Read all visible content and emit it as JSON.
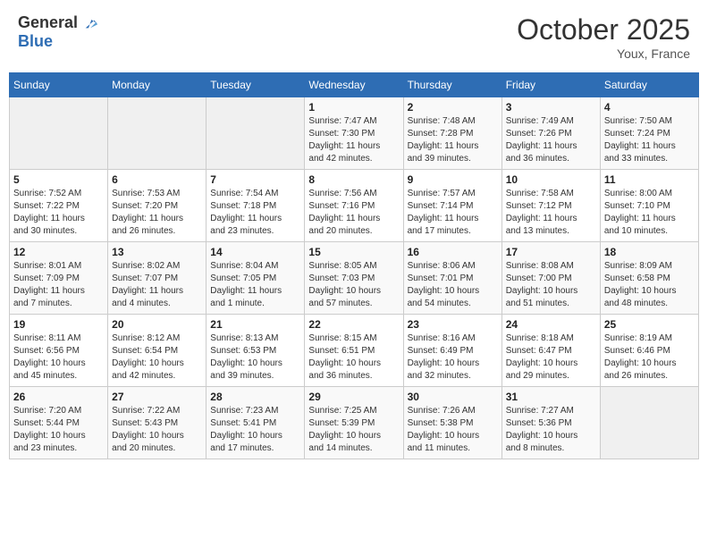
{
  "header": {
    "logo_general": "General",
    "logo_blue": "Blue",
    "month": "October 2025",
    "location": "Youx, France"
  },
  "weekdays": [
    "Sunday",
    "Monday",
    "Tuesday",
    "Wednesday",
    "Thursday",
    "Friday",
    "Saturday"
  ],
  "weeks": [
    [
      {
        "day": "",
        "info": ""
      },
      {
        "day": "",
        "info": ""
      },
      {
        "day": "",
        "info": ""
      },
      {
        "day": "1",
        "info": "Sunrise: 7:47 AM\nSunset: 7:30 PM\nDaylight: 11 hours\nand 42 minutes."
      },
      {
        "day": "2",
        "info": "Sunrise: 7:48 AM\nSunset: 7:28 PM\nDaylight: 11 hours\nand 39 minutes."
      },
      {
        "day": "3",
        "info": "Sunrise: 7:49 AM\nSunset: 7:26 PM\nDaylight: 11 hours\nand 36 minutes."
      },
      {
        "day": "4",
        "info": "Sunrise: 7:50 AM\nSunset: 7:24 PM\nDaylight: 11 hours\nand 33 minutes."
      }
    ],
    [
      {
        "day": "5",
        "info": "Sunrise: 7:52 AM\nSunset: 7:22 PM\nDaylight: 11 hours\nand 30 minutes."
      },
      {
        "day": "6",
        "info": "Sunrise: 7:53 AM\nSunset: 7:20 PM\nDaylight: 11 hours\nand 26 minutes."
      },
      {
        "day": "7",
        "info": "Sunrise: 7:54 AM\nSunset: 7:18 PM\nDaylight: 11 hours\nand 23 minutes."
      },
      {
        "day": "8",
        "info": "Sunrise: 7:56 AM\nSunset: 7:16 PM\nDaylight: 11 hours\nand 20 minutes."
      },
      {
        "day": "9",
        "info": "Sunrise: 7:57 AM\nSunset: 7:14 PM\nDaylight: 11 hours\nand 17 minutes."
      },
      {
        "day": "10",
        "info": "Sunrise: 7:58 AM\nSunset: 7:12 PM\nDaylight: 11 hours\nand 13 minutes."
      },
      {
        "day": "11",
        "info": "Sunrise: 8:00 AM\nSunset: 7:10 PM\nDaylight: 11 hours\nand 10 minutes."
      }
    ],
    [
      {
        "day": "12",
        "info": "Sunrise: 8:01 AM\nSunset: 7:09 PM\nDaylight: 11 hours\nand 7 minutes."
      },
      {
        "day": "13",
        "info": "Sunrise: 8:02 AM\nSunset: 7:07 PM\nDaylight: 11 hours\nand 4 minutes."
      },
      {
        "day": "14",
        "info": "Sunrise: 8:04 AM\nSunset: 7:05 PM\nDaylight: 11 hours\nand 1 minute."
      },
      {
        "day": "15",
        "info": "Sunrise: 8:05 AM\nSunset: 7:03 PM\nDaylight: 10 hours\nand 57 minutes."
      },
      {
        "day": "16",
        "info": "Sunrise: 8:06 AM\nSunset: 7:01 PM\nDaylight: 10 hours\nand 54 minutes."
      },
      {
        "day": "17",
        "info": "Sunrise: 8:08 AM\nSunset: 7:00 PM\nDaylight: 10 hours\nand 51 minutes."
      },
      {
        "day": "18",
        "info": "Sunrise: 8:09 AM\nSunset: 6:58 PM\nDaylight: 10 hours\nand 48 minutes."
      }
    ],
    [
      {
        "day": "19",
        "info": "Sunrise: 8:11 AM\nSunset: 6:56 PM\nDaylight: 10 hours\nand 45 minutes."
      },
      {
        "day": "20",
        "info": "Sunrise: 8:12 AM\nSunset: 6:54 PM\nDaylight: 10 hours\nand 42 minutes."
      },
      {
        "day": "21",
        "info": "Sunrise: 8:13 AM\nSunset: 6:53 PM\nDaylight: 10 hours\nand 39 minutes."
      },
      {
        "day": "22",
        "info": "Sunrise: 8:15 AM\nSunset: 6:51 PM\nDaylight: 10 hours\nand 36 minutes."
      },
      {
        "day": "23",
        "info": "Sunrise: 8:16 AM\nSunset: 6:49 PM\nDaylight: 10 hours\nand 32 minutes."
      },
      {
        "day": "24",
        "info": "Sunrise: 8:18 AM\nSunset: 6:47 PM\nDaylight: 10 hours\nand 29 minutes."
      },
      {
        "day": "25",
        "info": "Sunrise: 8:19 AM\nSunset: 6:46 PM\nDaylight: 10 hours\nand 26 minutes."
      }
    ],
    [
      {
        "day": "26",
        "info": "Sunrise: 7:20 AM\nSunset: 5:44 PM\nDaylight: 10 hours\nand 23 minutes."
      },
      {
        "day": "27",
        "info": "Sunrise: 7:22 AM\nSunset: 5:43 PM\nDaylight: 10 hours\nand 20 minutes."
      },
      {
        "day": "28",
        "info": "Sunrise: 7:23 AM\nSunset: 5:41 PM\nDaylight: 10 hours\nand 17 minutes."
      },
      {
        "day": "29",
        "info": "Sunrise: 7:25 AM\nSunset: 5:39 PM\nDaylight: 10 hours\nand 14 minutes."
      },
      {
        "day": "30",
        "info": "Sunrise: 7:26 AM\nSunset: 5:38 PM\nDaylight: 10 hours\nand 11 minutes."
      },
      {
        "day": "31",
        "info": "Sunrise: 7:27 AM\nSunset: 5:36 PM\nDaylight: 10 hours\nand 8 minutes."
      },
      {
        "day": "",
        "info": ""
      }
    ]
  ]
}
